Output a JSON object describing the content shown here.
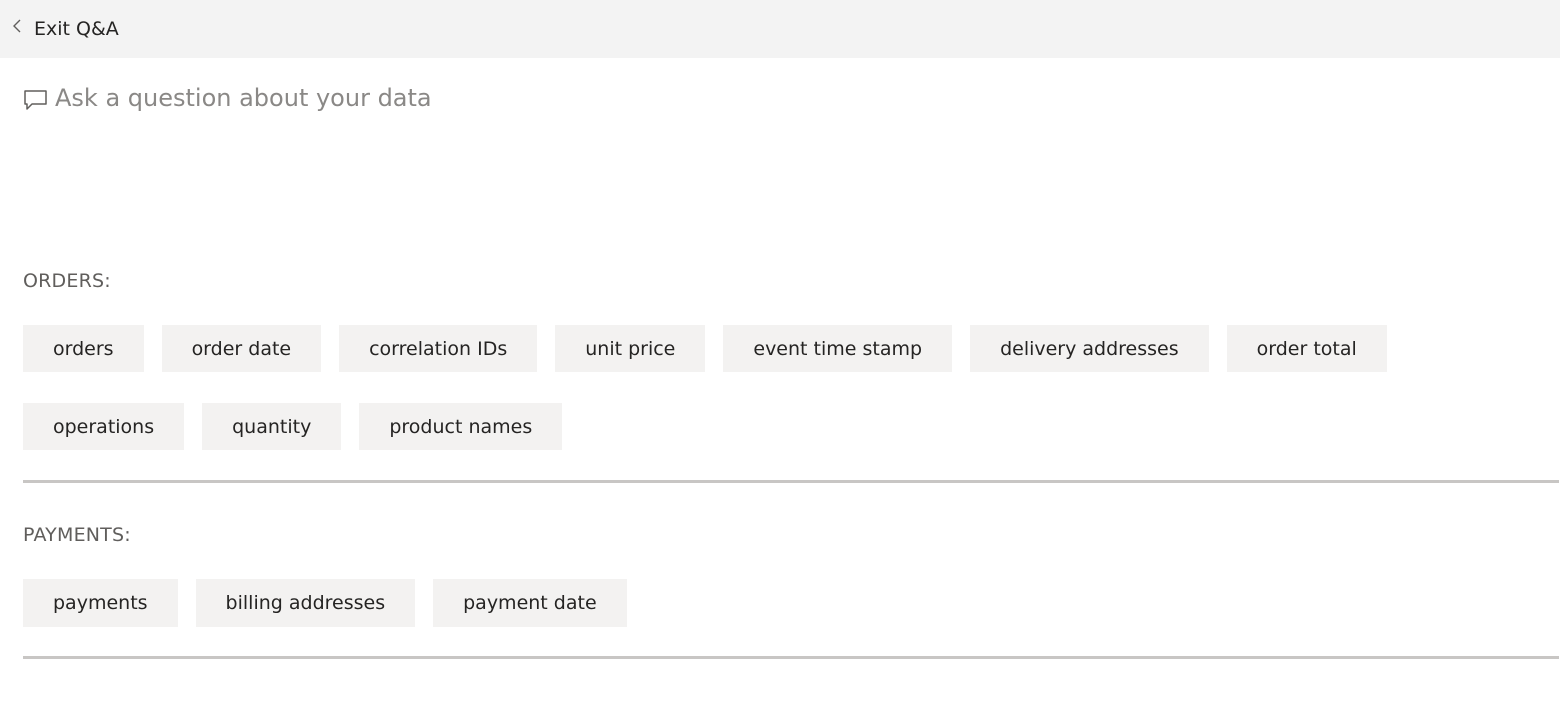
{
  "header": {
    "exit_label": "Exit Q&A",
    "exit_icon": "chevron-left-icon"
  },
  "ask": {
    "icon": "speech-bubble-icon",
    "placeholder": "Ask a question about your data",
    "value": ""
  },
  "sections": [
    {
      "label": "ORDERS:",
      "rows": [
        [
          "orders",
          "order date",
          "correlation IDs",
          "unit price",
          "event time stamp",
          "delivery addresses",
          "order total"
        ],
        [
          "operations",
          "quantity",
          "product names"
        ]
      ]
    },
    {
      "label": "PAYMENTS:",
      "rows": [
        [
          "payments",
          "billing addresses",
          "payment date"
        ]
      ]
    }
  ],
  "colors": {
    "topbar_bg": "#f3f3f3",
    "chip_bg": "#f3f2f1",
    "divider": "#c8c6c4",
    "placeholder": "#8a8886"
  }
}
